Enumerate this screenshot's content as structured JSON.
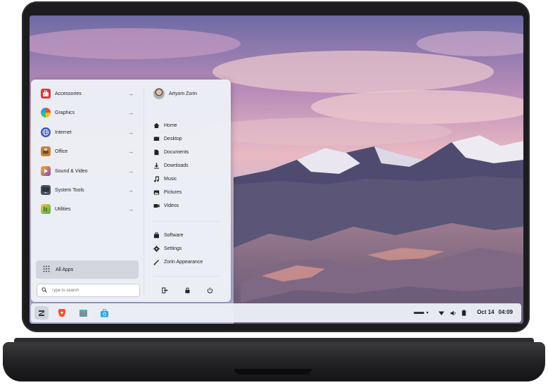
{
  "start_menu": {
    "categories": [
      {
        "label": "Accessories",
        "icon": "toolbox-icon",
        "color": "#d83a3a"
      },
      {
        "label": "Graphics",
        "icon": "graphics-icon",
        "color": "#e8742c"
      },
      {
        "label": "Internet",
        "icon": "globe-icon",
        "color": "#3a5bbd"
      },
      {
        "label": "Office",
        "icon": "briefcase-icon",
        "color": "#c9823a"
      },
      {
        "label": "Sound & Video",
        "icon": "media-icon",
        "color": "#8a46c0"
      },
      {
        "label": "System Tools",
        "icon": "monitor-icon",
        "color": "#4a5563"
      },
      {
        "label": "Utilities",
        "icon": "utilities-icon",
        "color": "#4caf50"
      }
    ],
    "all_apps_label": "All Apps",
    "search_placeholder": "Type to search",
    "user_name": "Artyom Zorin",
    "places": [
      {
        "label": "Home",
        "icon": "home-icon"
      },
      {
        "label": "Desktop",
        "icon": "desktop-icon"
      },
      {
        "label": "Documents",
        "icon": "document-icon"
      },
      {
        "label": "Downloads",
        "icon": "download-icon"
      },
      {
        "label": "Music",
        "icon": "music-icon"
      },
      {
        "label": "Pictures",
        "icon": "picture-icon"
      },
      {
        "label": "Videos",
        "icon": "video-icon"
      }
    ],
    "system": [
      {
        "label": "Software",
        "icon": "software-icon"
      },
      {
        "label": "Settings",
        "icon": "settings-icon"
      },
      {
        "label": "Zorin Appearance",
        "icon": "appearance-icon"
      }
    ]
  },
  "taskbar": {
    "apps": [
      "zorin-menu-icon",
      "brave-browser-icon",
      "files-icon",
      "software-store-icon"
    ],
    "tray_icons": [
      "network-icon",
      "volume-icon",
      "battery-icon"
    ],
    "date": "Oct 14",
    "time": "04:09"
  }
}
